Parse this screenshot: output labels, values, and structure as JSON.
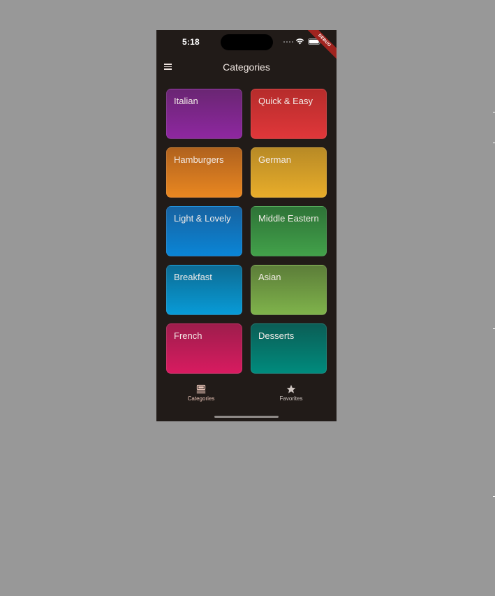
{
  "status_bar": {
    "time": "5:18",
    "debug_label": "DEBUG"
  },
  "app_bar": {
    "title": "Categories",
    "menu_icon": "hamburger-menu-icon"
  },
  "categories": [
    {
      "label": "Italian",
      "color_top": "#6a2673",
      "color_bottom": "#8e27a0"
    },
    {
      "label": "Quick & Easy",
      "color_top": "#b62c2b",
      "color_bottom": "#e0373a"
    },
    {
      "label": "Hamburgers",
      "color_top": "#b0621e",
      "color_bottom": "#e98721"
    },
    {
      "label": "German",
      "color_top": "#b88a26",
      "color_bottom": "#e8ad2a"
    },
    {
      "label": "Light & Lovely",
      "color_top": "#1762a0",
      "color_bottom": "#0a85d6"
    },
    {
      "label": "Middle Eastern",
      "color_top": "#2e7337",
      "color_bottom": "#42a14a"
    },
    {
      "label": "Breakfast",
      "color_top": "#0d6b93",
      "color_bottom": "#089bd7"
    },
    {
      "label": "Asian",
      "color_top": "#5c7d39",
      "color_bottom": "#7fb34b"
    },
    {
      "label": "French",
      "color_top": "#9e1d4c",
      "color_bottom": "#d81b60"
    },
    {
      "label": "Desserts",
      "color_top": "#0b5e56",
      "color_bottom": "#008b7d"
    }
  ],
  "bottom_nav": {
    "items": [
      {
        "label": "Categories",
        "icon": "set-meal-icon",
        "active": true
      },
      {
        "label": "Favorites",
        "icon": "star-icon",
        "active": false
      }
    ],
    "active_color": "#e7c3b6",
    "inactive_color": "#cfc6c2"
  }
}
